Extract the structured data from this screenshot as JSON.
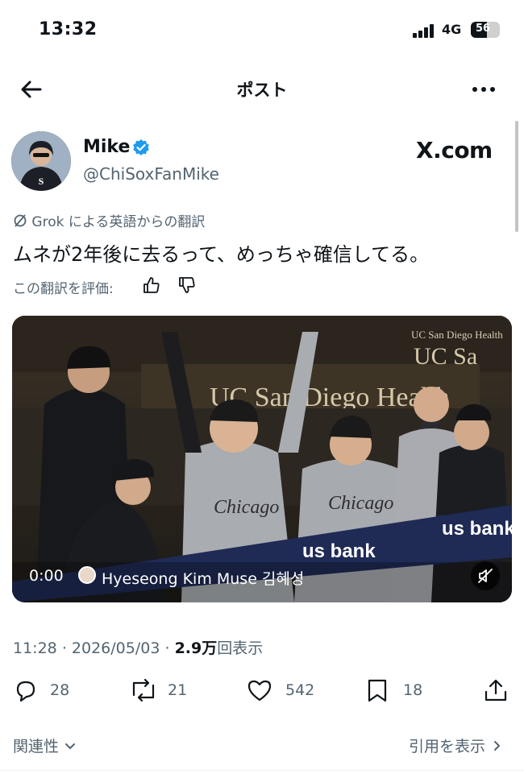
{
  "status_bar": {
    "time": "13:32",
    "network": "4G",
    "battery": "56",
    "battery_level": 0.56
  },
  "nav": {
    "title": "ポスト",
    "back_icon": "arrow-left-icon",
    "more_icon": "more-dots-icon"
  },
  "author": {
    "display_name": "Mike",
    "handle": "@ChiSoxFanMike",
    "verified": true,
    "verified_color": "#1d9bf0",
    "source_label": "X.com"
  },
  "translation": {
    "label": "Grok による英語からの翻訳",
    "icon": "grok-icon"
  },
  "post": {
    "text": "ムネが2年後に去るって、めっちゃ確信してる。"
  },
  "rate": {
    "label": "この翻訳を評価:",
    "up_icon": "thumbs-up-icon",
    "down_icon": "thumbs-down-icon"
  },
  "video": {
    "time": "0:00",
    "creator": "Hyeseong Kim Muse 김혜성",
    "signage": {
      "uc_health": "UC San Diego Health",
      "us_bank": "us bank",
      "jersey": "Chicago"
    },
    "muted": true
  },
  "meta": {
    "time": "11:28",
    "date": "2026/05/03",
    "views_value": "2.9",
    "views_unit": "万",
    "views_label": "回表示"
  },
  "actions": {
    "replies": "28",
    "reposts": "21",
    "likes": "542",
    "bookmarks": "18"
  },
  "footer": {
    "related": "関連性",
    "quotes": "引用を表示"
  },
  "colors": {
    "text": "#0f1419",
    "secondary": "#536471",
    "accent": "#1d9bf0"
  }
}
